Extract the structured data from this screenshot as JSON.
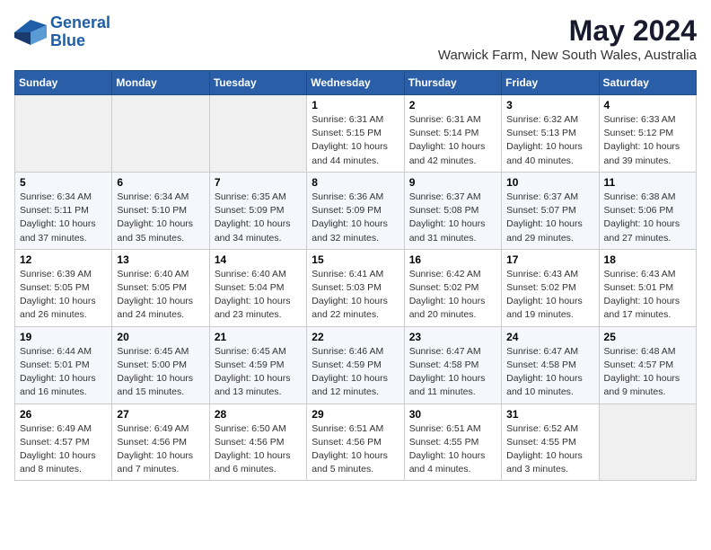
{
  "logo": {
    "line1": "General",
    "line2": "Blue"
  },
  "title": "May 2024",
  "location": "Warwick Farm, New South Wales, Australia",
  "weekdays": [
    "Sunday",
    "Monday",
    "Tuesday",
    "Wednesday",
    "Thursday",
    "Friday",
    "Saturday"
  ],
  "weeks": [
    [
      {
        "day": "",
        "info": ""
      },
      {
        "day": "",
        "info": ""
      },
      {
        "day": "",
        "info": ""
      },
      {
        "day": "1",
        "info": "Sunrise: 6:31 AM\nSunset: 5:15 PM\nDaylight: 10 hours\nand 44 minutes."
      },
      {
        "day": "2",
        "info": "Sunrise: 6:31 AM\nSunset: 5:14 PM\nDaylight: 10 hours\nand 42 minutes."
      },
      {
        "day": "3",
        "info": "Sunrise: 6:32 AM\nSunset: 5:13 PM\nDaylight: 10 hours\nand 40 minutes."
      },
      {
        "day": "4",
        "info": "Sunrise: 6:33 AM\nSunset: 5:12 PM\nDaylight: 10 hours\nand 39 minutes."
      }
    ],
    [
      {
        "day": "5",
        "info": "Sunrise: 6:34 AM\nSunset: 5:11 PM\nDaylight: 10 hours\nand 37 minutes."
      },
      {
        "day": "6",
        "info": "Sunrise: 6:34 AM\nSunset: 5:10 PM\nDaylight: 10 hours\nand 35 minutes."
      },
      {
        "day": "7",
        "info": "Sunrise: 6:35 AM\nSunset: 5:09 PM\nDaylight: 10 hours\nand 34 minutes."
      },
      {
        "day": "8",
        "info": "Sunrise: 6:36 AM\nSunset: 5:09 PM\nDaylight: 10 hours\nand 32 minutes."
      },
      {
        "day": "9",
        "info": "Sunrise: 6:37 AM\nSunset: 5:08 PM\nDaylight: 10 hours\nand 31 minutes."
      },
      {
        "day": "10",
        "info": "Sunrise: 6:37 AM\nSunset: 5:07 PM\nDaylight: 10 hours\nand 29 minutes."
      },
      {
        "day": "11",
        "info": "Sunrise: 6:38 AM\nSunset: 5:06 PM\nDaylight: 10 hours\nand 27 minutes."
      }
    ],
    [
      {
        "day": "12",
        "info": "Sunrise: 6:39 AM\nSunset: 5:05 PM\nDaylight: 10 hours\nand 26 minutes."
      },
      {
        "day": "13",
        "info": "Sunrise: 6:40 AM\nSunset: 5:05 PM\nDaylight: 10 hours\nand 24 minutes."
      },
      {
        "day": "14",
        "info": "Sunrise: 6:40 AM\nSunset: 5:04 PM\nDaylight: 10 hours\nand 23 minutes."
      },
      {
        "day": "15",
        "info": "Sunrise: 6:41 AM\nSunset: 5:03 PM\nDaylight: 10 hours\nand 22 minutes."
      },
      {
        "day": "16",
        "info": "Sunrise: 6:42 AM\nSunset: 5:02 PM\nDaylight: 10 hours\nand 20 minutes."
      },
      {
        "day": "17",
        "info": "Sunrise: 6:43 AM\nSunset: 5:02 PM\nDaylight: 10 hours\nand 19 minutes."
      },
      {
        "day": "18",
        "info": "Sunrise: 6:43 AM\nSunset: 5:01 PM\nDaylight: 10 hours\nand 17 minutes."
      }
    ],
    [
      {
        "day": "19",
        "info": "Sunrise: 6:44 AM\nSunset: 5:01 PM\nDaylight: 10 hours\nand 16 minutes."
      },
      {
        "day": "20",
        "info": "Sunrise: 6:45 AM\nSunset: 5:00 PM\nDaylight: 10 hours\nand 15 minutes."
      },
      {
        "day": "21",
        "info": "Sunrise: 6:45 AM\nSunset: 4:59 PM\nDaylight: 10 hours\nand 13 minutes."
      },
      {
        "day": "22",
        "info": "Sunrise: 6:46 AM\nSunset: 4:59 PM\nDaylight: 10 hours\nand 12 minutes."
      },
      {
        "day": "23",
        "info": "Sunrise: 6:47 AM\nSunset: 4:58 PM\nDaylight: 10 hours\nand 11 minutes."
      },
      {
        "day": "24",
        "info": "Sunrise: 6:47 AM\nSunset: 4:58 PM\nDaylight: 10 hours\nand 10 minutes."
      },
      {
        "day": "25",
        "info": "Sunrise: 6:48 AM\nSunset: 4:57 PM\nDaylight: 10 hours\nand 9 minutes."
      }
    ],
    [
      {
        "day": "26",
        "info": "Sunrise: 6:49 AM\nSunset: 4:57 PM\nDaylight: 10 hours\nand 8 minutes."
      },
      {
        "day": "27",
        "info": "Sunrise: 6:49 AM\nSunset: 4:56 PM\nDaylight: 10 hours\nand 7 minutes."
      },
      {
        "day": "28",
        "info": "Sunrise: 6:50 AM\nSunset: 4:56 PM\nDaylight: 10 hours\nand 6 minutes."
      },
      {
        "day": "29",
        "info": "Sunrise: 6:51 AM\nSunset: 4:56 PM\nDaylight: 10 hours\nand 5 minutes."
      },
      {
        "day": "30",
        "info": "Sunrise: 6:51 AM\nSunset: 4:55 PM\nDaylight: 10 hours\nand 4 minutes."
      },
      {
        "day": "31",
        "info": "Sunrise: 6:52 AM\nSunset: 4:55 PM\nDaylight: 10 hours\nand 3 minutes."
      },
      {
        "day": "",
        "info": ""
      }
    ]
  ]
}
